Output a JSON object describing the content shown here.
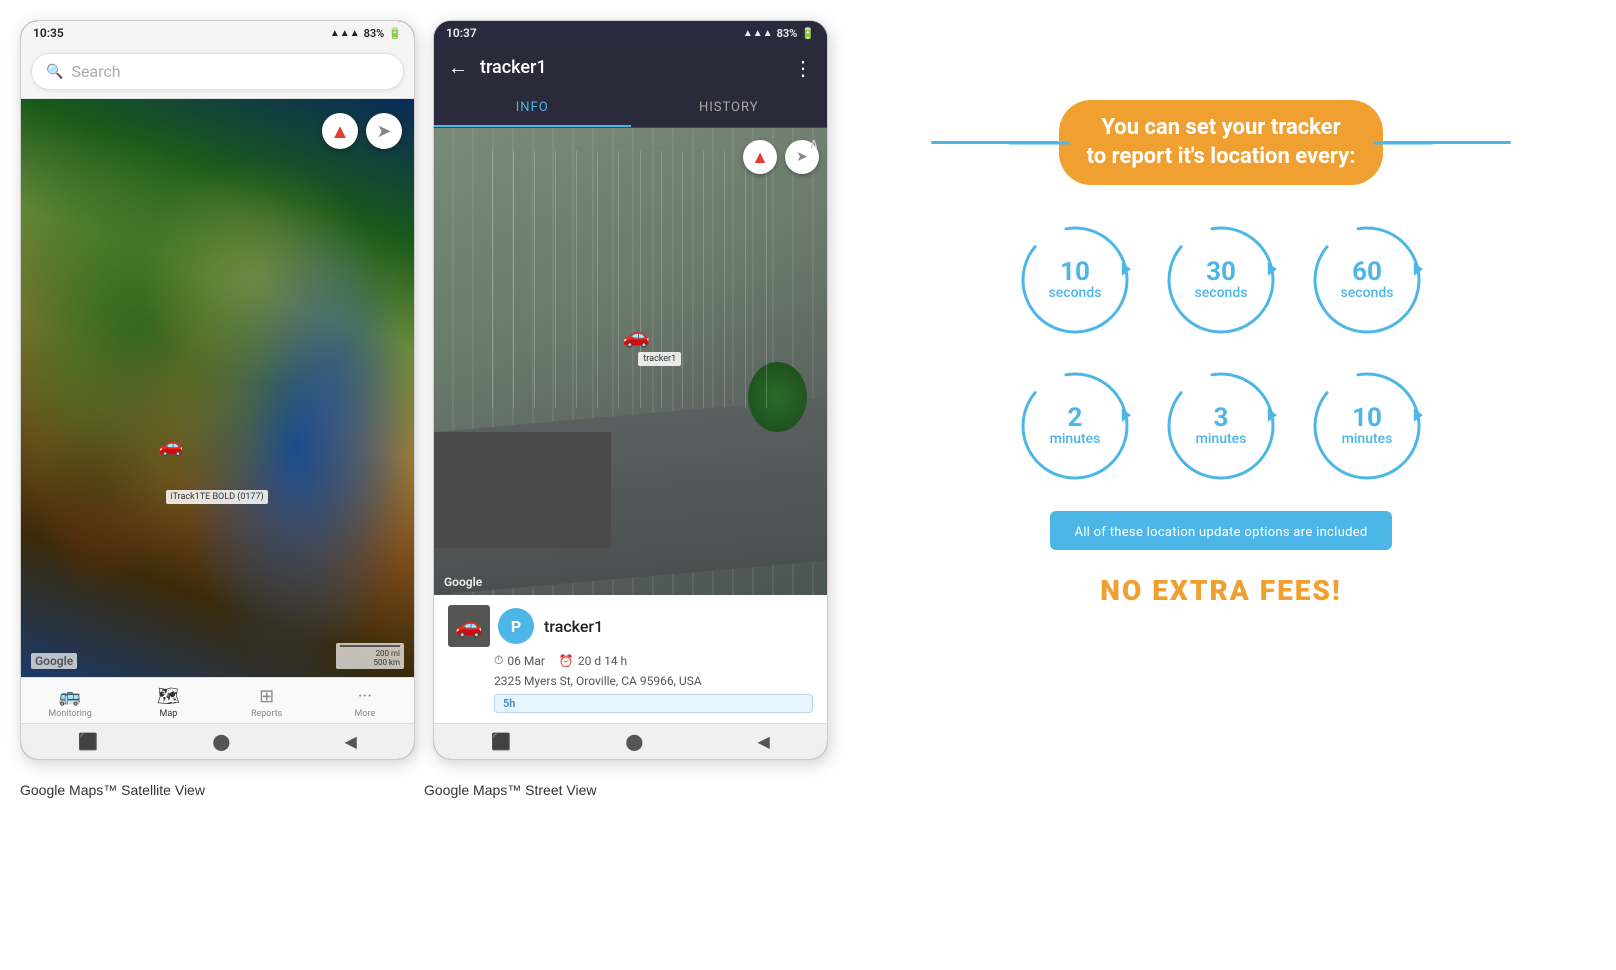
{
  "phone1": {
    "status_time": "10:35",
    "status_signal": "▲▲▲",
    "status_battery": "83%",
    "search_placeholder": "Search",
    "map_label": "iTrack1TE BOLD (0177)",
    "google_logo": "Google",
    "scale_text": "200 mi\n500 km",
    "compass_symbol": "🧭",
    "nav": [
      {
        "label": "Monitoring",
        "icon": "🚌",
        "active": false
      },
      {
        "label": "Map",
        "icon": "🗺",
        "active": true
      },
      {
        "label": "Reports",
        "icon": "⊞",
        "active": false
      },
      {
        "label": "More",
        "icon": "···",
        "active": false
      }
    ],
    "caption": "Google Maps™ Satellite View"
  },
  "phone2": {
    "status_time": "10:37",
    "status_signal": "▲▲▲",
    "status_battery": "83%",
    "tracker_name": "tracker1",
    "tab_info": "INFO",
    "tab_history": "HISTORY",
    "google_logo": "Google",
    "tracker_info": {
      "name": "tracker1",
      "avatar_letter": "P",
      "date": "06 Mar",
      "duration": "20 d 14 h",
      "address": "2325 Myers St, Oroville, CA 95966, USA",
      "badge": "5h"
    },
    "map_label": "tracker1",
    "caption": "Google Maps™ Street View"
  },
  "infographic": {
    "headline_line1": "You can set your tracker",
    "headline_line2": "to report it's location every:",
    "circles_row1": [
      {
        "number": "10",
        "unit": "seconds"
      },
      {
        "number": "30",
        "unit": "seconds"
      },
      {
        "number": "60",
        "unit": "seconds"
      }
    ],
    "circles_row2": [
      {
        "number": "2",
        "unit": "minutes"
      },
      {
        "number": "3",
        "unit": "minutes"
      },
      {
        "number": "10",
        "unit": "minutes"
      }
    ],
    "included_text": "All of these location update options are included",
    "no_fees_text": "NO EXTRA FEES!"
  }
}
